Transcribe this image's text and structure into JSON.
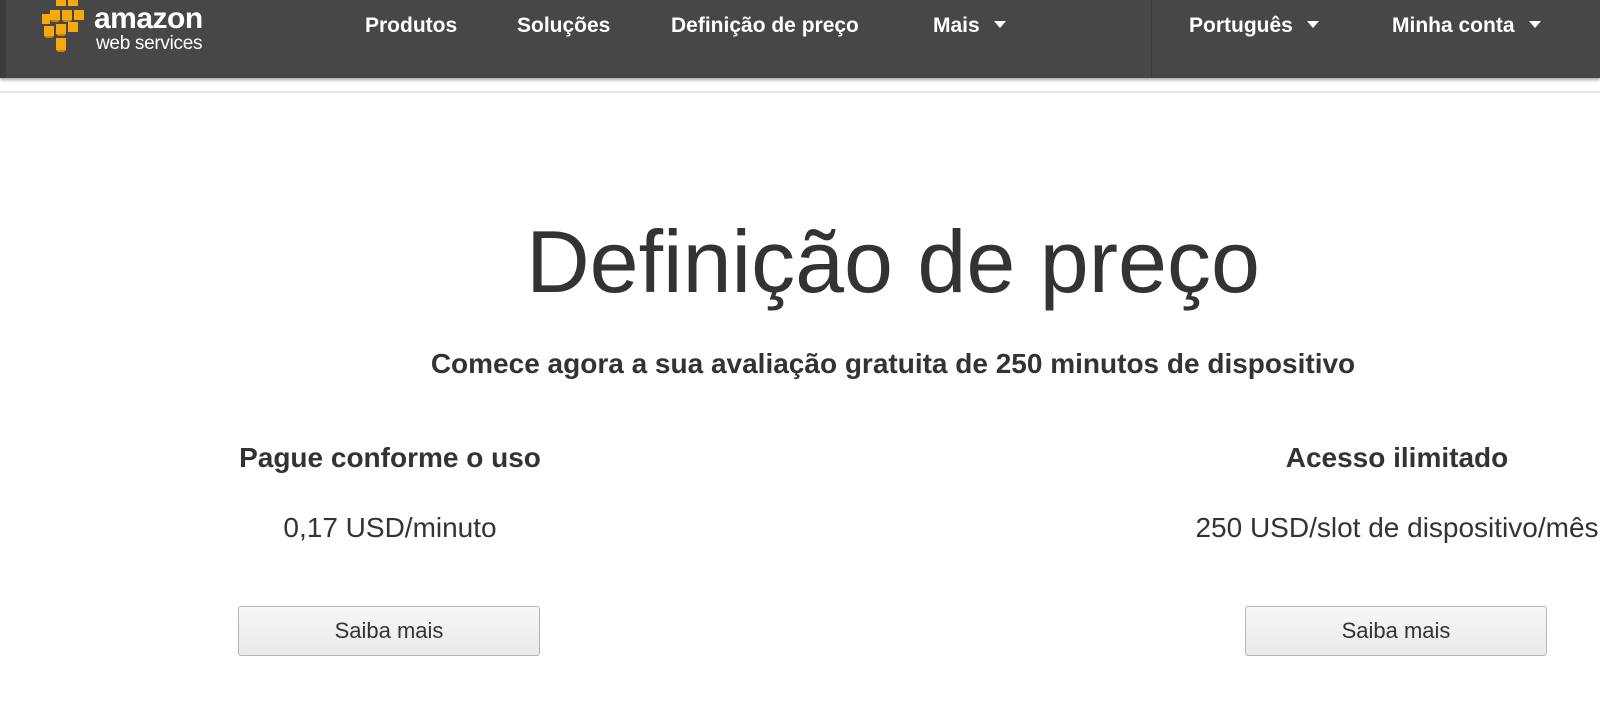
{
  "brand": {
    "logo_line1": "amazon",
    "logo_line2": "web services",
    "logo_color": "#f7a80d"
  },
  "nav": {
    "items": [
      {
        "label": "Produtos"
      },
      {
        "label": "Soluções"
      },
      {
        "label": "Definição de preço"
      },
      {
        "label": "Mais",
        "icon": "chevron-down-icon"
      }
    ],
    "language": {
      "label": "Português",
      "icon": "chevron-down-icon"
    },
    "account": {
      "label": "Minha conta",
      "icon": "chevron-down-icon"
    },
    "background": "#474747"
  },
  "main": {
    "title": "Definição de preço",
    "subtitle": "Comece agora a sua avaliação gratuita de 250 minutos de dispositivo",
    "plans": [
      {
        "heading": "Pague conforme o uso",
        "price": "0,17 USD/minuto",
        "button_label": "Saiba mais"
      },
      {
        "heading": "Acesso ilimitado",
        "price": "250 USD/slot de dispositivo/mês",
        "button_label": "Saiba mais"
      }
    ]
  }
}
